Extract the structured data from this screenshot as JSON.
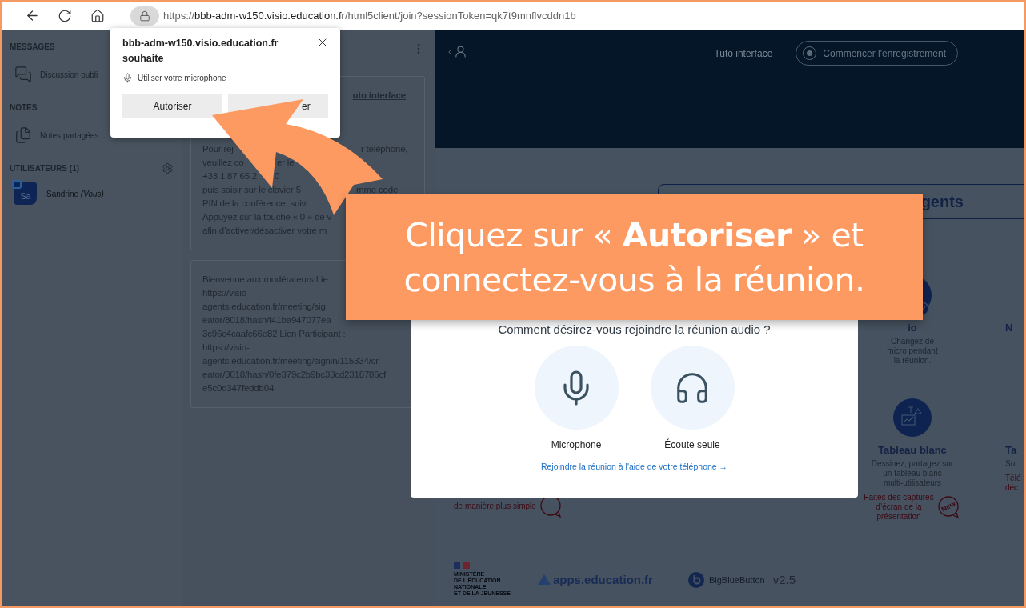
{
  "browser": {
    "url": {
      "scheme": "https://",
      "host": "bbb-adm-w150.visio.education.fr",
      "path": "/html5client/join?sessionToken=qk7t9mnflvcddn1b"
    }
  },
  "permission_prompt": {
    "title": "bbb-adm-w150.visio.education.fr souhaite",
    "request": "Utiliser votre microphone",
    "buttons": [
      {
        "label": "Autoriser",
        "kind": "allow"
      },
      {
        "label": "er",
        "kind": "block"
      }
    ]
  },
  "sidebar": {
    "sections": [
      {
        "kind": "links",
        "heading": "MESSAGES",
        "items": [
          {
            "label": "Discussion publi",
            "kind": "chat"
          }
        ]
      },
      {
        "kind": "links",
        "heading": "NOTES",
        "items": [
          {
            "label": "Notes partagées",
            "kind": "notes"
          }
        ]
      },
      {
        "kind": "users",
        "heading": "UTILISATEURS (1)",
        "users": [
          {
            "initials": "Sa",
            "name": "Sandrine *(Vous)*"
          }
        ]
      }
    ]
  },
  "chat_panel": {
    "messages": [
      {
        "lines": [
          {
            "kind": "cut_start",
            "fragments": [
              {
                "text": "uto interface",
                "link": true
              },
              {
                "text": " .",
                "link": false
              }
            ]
          },
          {
            "kind": "split",
            "fragments": [
              {
                "text": "Pour rej",
                "link": false
              },
              {
                "text": "r téléphone,",
                "link": false
              }
            ]
          },
          {
            "kind": "split",
            "fragments": [
              {
                "text": "veuillez co",
                "link": false
              },
              {
                "text": "er le",
                "link": false
              }
            ]
          },
          {
            "kind": "split",
            "fragments": [
              {
                "text": "+33 1 87 65 2",
                "link": false
              },
              {
                "text": "0",
                "link": false
              }
            ]
          },
          {
            "kind": "split",
            "fragments": [
              {
                "text": "puis saisir sur le clavier 5",
                "link": false
              },
              {
                "text": "mme code",
                "link": false
              }
            ]
          },
          {
            "kind": "split",
            "fragments": [
              {
                "text": "PIN de la conférence, suivi",
                "link": false
              }
            ]
          },
          {
            "kind": "split",
            "fragments": [
              {
                "text": "Appuyez sur la touche « 0 » de v",
                "link": false
              }
            ]
          },
          {
            "kind": "split",
            "fragments": [
              {
                "text": "afin d’activer/désactiver votre m",
                "link": false
              }
            ]
          }
        ]
      },
      {
        "lines": [
          {
            "kind": "split",
            "fragments": [
              {
                "text": "Bienvenue aux modérateurs Lie",
                "link": false
              }
            ]
          },
          {
            "kind": "split",
            "fragments": [
              {
                "text": "https://visio-",
                "link": false
              }
            ]
          },
          {
            "kind": "split",
            "fragments": [
              {
                "text": "agents.education.fr/meeting/sig",
                "link": false
              }
            ]
          },
          {
            "kind": "split",
            "fragments": [
              {
                "text": "eator/8018/hash/f41ba947077ea",
                "link": false
              }
            ]
          },
          {
            "kind": "split",
            "fragments": [
              {
                "text": "3c96c4caafc66e82 Lien Participant :",
                "link": false
              }
            ]
          },
          {
            "kind": "split",
            "fragments": [
              {
                "text": "https://visio-",
                "link": false
              }
            ]
          },
          {
            "kind": "split",
            "fragments": [
              {
                "text": "agents.education.fr/meeting/signin/115334/cr",
                "link": false
              }
            ]
          },
          {
            "kind": "split",
            "fragments": [
              {
                "text": "eator/8018/hash/0fe379c2b9bc33cd2318786cf",
                "link": false
              }
            ]
          },
          {
            "kind": "split",
            "fragments": [
              {
                "text": "e5c0d347feddb04",
                "link": false
              }
            ]
          }
        ]
      }
    ]
  },
  "header": {
    "tutorial": "Tuto interface",
    "record_button": "Commencer l'enregistrement"
  },
  "landing": {
    "title": "gents",
    "feature_rows": [
      [
        {
          "kind": "feature",
          "title": "io",
          "description": [
            "Changez de",
            "micro pendant",
            "la réunion."
          ]
        },
        {
          "kind": "cut",
          "title": "N"
        }
      ],
      [
        {
          "kind": "note",
          "note": [
            "de manière plus simple"
          ]
        },
        {
          "kind": "feature",
          "title": "Tableau blanc",
          "description": [
            "Dessinez, partagez sur",
            "un tableau blanc",
            "multi-utilisateurs"
          ],
          "note": [
            "Faites des captures",
            "d’écran de la",
            "présentation"
          ],
          "badge": "New"
        },
        {
          "kind": "cut",
          "title": "Ta",
          "description": [
            "Sui"
          ],
          "note": [
            "Télé",
            "déc"
          ]
        }
      ]
    ]
  },
  "footer": {
    "ministry": [
      "MINISTÈRE",
      "DE L’ÉDUCATION",
      "NATIONALE",
      "ET DE LA JEUNESSE"
    ],
    "apps": "apps.education.fr",
    "bbb": "BigBlueButton",
    "version": "v2.5"
  },
  "audio_modal": {
    "question": "Comment désirez-vous rejoindre la réunion audio ?",
    "options": [
      {
        "label": "Microphone",
        "kind": "microphone"
      },
      {
        "label": "Écoute seule",
        "kind": "listen"
      }
    ],
    "phone_link": "Rejoindre la réunion à l'aide de votre téléphone →"
  },
  "callout": {
    "lines": [
      "Cliquez sur « **Autoriser** » et",
      "connectez-vous à la réunion."
    ]
  }
}
